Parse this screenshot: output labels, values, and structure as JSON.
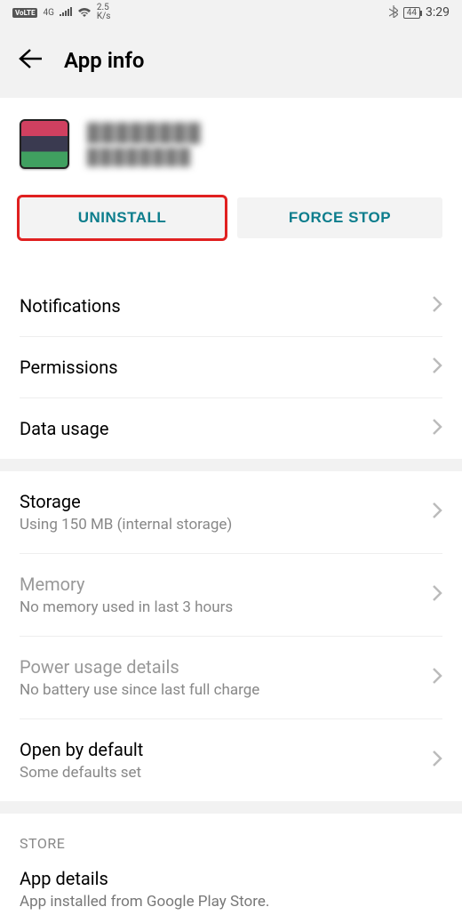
{
  "statusbar": {
    "volte": "VoLTE",
    "net_gen": "4G",
    "speed_top": "2.5",
    "speed_bot": "K/s",
    "battery": "44",
    "time": "3:29"
  },
  "header": {
    "title": "App info"
  },
  "app": {
    "name_l1": "████████",
    "name_l2": "████████"
  },
  "buttons": {
    "uninstall": "UNINSTALL",
    "force_stop": "FORCE STOP"
  },
  "rows": {
    "notifications": "Notifications",
    "permissions": "Permissions",
    "data_usage": "Data usage",
    "storage_t": "Storage",
    "storage_s": "Using 150 MB (internal storage)",
    "memory_t": "Memory",
    "memory_s": "No memory used in last 3 hours",
    "power_t": "Power usage details",
    "power_s": "No battery use since last full charge",
    "open_t": "Open by default",
    "open_s": "Some defaults set"
  },
  "store": {
    "label": "STORE",
    "details_t": "App details",
    "details_s": "App installed from Google Play Store."
  }
}
